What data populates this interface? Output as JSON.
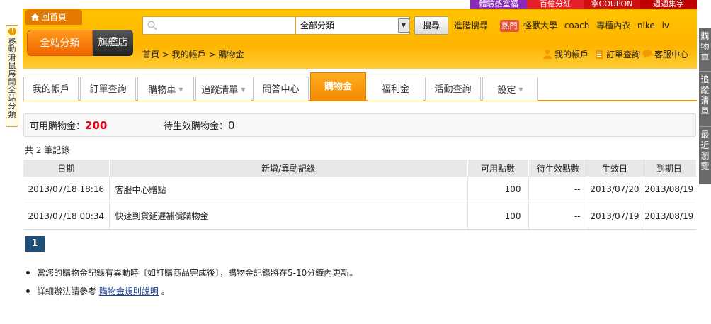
{
  "promos": [
    {
      "label": "體驗感室福",
      "color": "#8a2bb8"
    },
    {
      "label": "百億分紅",
      "color": "#e6202a"
    },
    {
      "label": "拿COUPON",
      "color": "#d01010"
    },
    {
      "label": "週週集字",
      "color": "#c00000"
    }
  ],
  "header": {
    "home_label": "回首頁",
    "all_categories": "全站分類",
    "flagship": "旗艦店",
    "search_placeholder": "",
    "category_selected": "全部分類",
    "search_button": "搜尋",
    "advanced_search": "進階搜尋",
    "hot_badge": "熱門",
    "hot_words": "怪獸大學 coach 專櫃內衣 nike lv"
  },
  "breadcrumb": "首頁 > 我的帳戶 > 購物金",
  "top_links": [
    "我的帳戶",
    "訂單查詢",
    "客服中心"
  ],
  "left_bar": {
    "text": "移動滑鼠展開全站分類"
  },
  "right_bar": [
    "購物車",
    "追蹤清單",
    "最近瀏覽"
  ],
  "tabs": [
    {
      "label": "我的帳戶",
      "dropdown": false
    },
    {
      "label": "訂單查詢",
      "dropdown": false
    },
    {
      "label": "購物車",
      "dropdown": true
    },
    {
      "label": "追蹤清單",
      "dropdown": true
    },
    {
      "label": "問答中心",
      "dropdown": false
    },
    {
      "label": "購物金",
      "dropdown": false,
      "active": true
    },
    {
      "label": "福利金",
      "dropdown": false
    },
    {
      "label": "活動查詢",
      "dropdown": false
    },
    {
      "label": "設定",
      "dropdown": true
    }
  ],
  "balance": {
    "available_label": "可用購物金：",
    "available_value": "200",
    "pending_label": "待生效購物金：",
    "pending_value": "0"
  },
  "record_count": "共 2 筆記錄",
  "table": {
    "headers": [
      "日期",
      "新增/異動記錄",
      "可用點數",
      "待生效點數",
      "生效日",
      "到期日"
    ],
    "rows": [
      [
        "2013/07/18 18:16",
        "客服中心贈點",
        "100",
        "--",
        "2013/07/20",
        "2013/08/19"
      ],
      [
        "2013/07/18 00:34",
        "快速到貨延遲補償購物金",
        "100",
        "--",
        "2013/07/19",
        "2013/08/19"
      ]
    ]
  },
  "pager": {
    "current": "1"
  },
  "notes": {
    "line1": "當您的購物金記錄有異動時〔如訂購商品完成後〕，購物金記錄將在5-10分鐘內更新。",
    "line2_prefix": "詳細辦法請參考",
    "line2_link": "購物金規則說明",
    "line2_suffix": "。"
  }
}
